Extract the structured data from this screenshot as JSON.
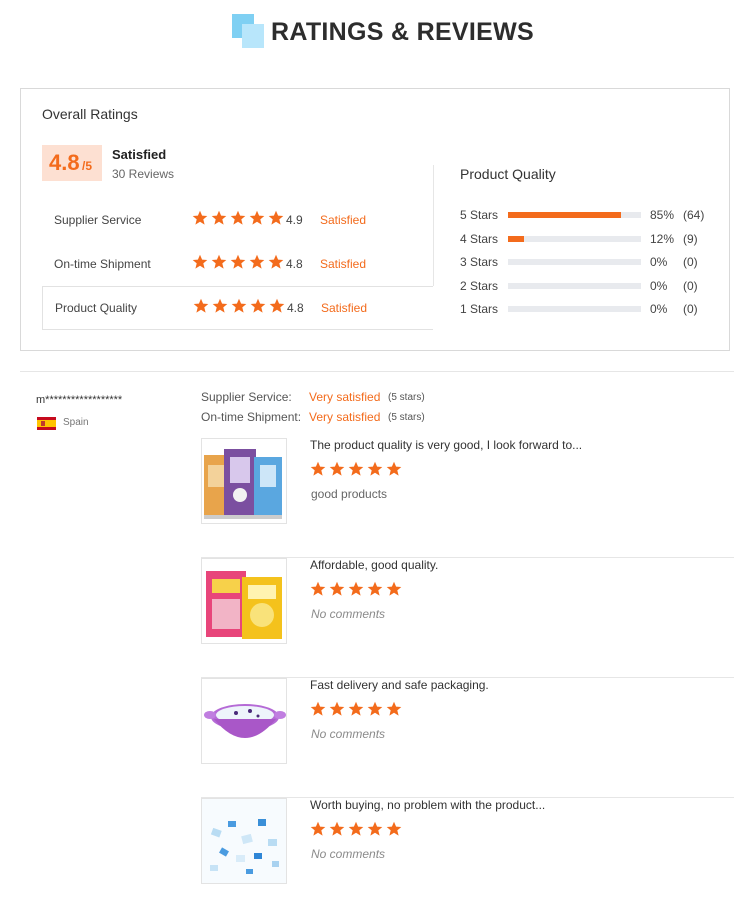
{
  "header": {
    "title": "RATINGS & REVIEWS"
  },
  "overall": {
    "title": "Overall Ratings",
    "score": "4.8",
    "score_max": "/5",
    "status": "Satisfied",
    "reviews": "30 Reviews",
    "metrics": [
      {
        "label": "Supplier Service",
        "value": "4.9",
        "status": "Satisfied"
      },
      {
        "label": "On-time Shipment",
        "value": "4.8",
        "status": "Satisfied"
      },
      {
        "label": "Product Quality",
        "value": "4.8",
        "status": "Satisfied"
      }
    ]
  },
  "product_quality": {
    "title": "Product Quality",
    "rows": [
      {
        "label": "5 Stars",
        "fraction": 0.85,
        "percent": "85%",
        "count": "(64)"
      },
      {
        "label": "4 Stars",
        "fraction": 0.12,
        "percent": "12%",
        "count": "(9)"
      },
      {
        "label": "3 Stars",
        "fraction": 0,
        "percent": "0%",
        "count": "(0)"
      },
      {
        "label": "2 Stars",
        "fraction": 0,
        "percent": "0%",
        "count": "(0)"
      },
      {
        "label": "1 Stars",
        "fraction": 0,
        "percent": "0%",
        "count": "(0)"
      }
    ]
  },
  "review": {
    "reviewer": "m******************",
    "country": "Spain",
    "supplier_label": "Supplier Service:",
    "supplier_value": "Very satisfied",
    "supplier_note": "(5 stars)",
    "shipment_label": "On-time Shipment:",
    "shipment_value": "Very satisfied",
    "shipment_note": "(5 stars)",
    "items": [
      {
        "text": "The product quality is very good, I look forward to...",
        "comment": "good products",
        "rating": 5
      },
      {
        "text": "Affordable, good quality.",
        "comment": "No comments",
        "rating": 5
      },
      {
        "text": "Fast delivery and safe packaging.",
        "comment": "No comments",
        "rating": 5
      },
      {
        "text": "Worth buying, no problem with the product...",
        "comment": "No comments",
        "rating": 5
      }
    ]
  },
  "colors": {
    "accent": "#f36b1c",
    "star": "#f36b1c",
    "track": "#e8eaee",
    "badge_bg": "#fde0d2"
  }
}
